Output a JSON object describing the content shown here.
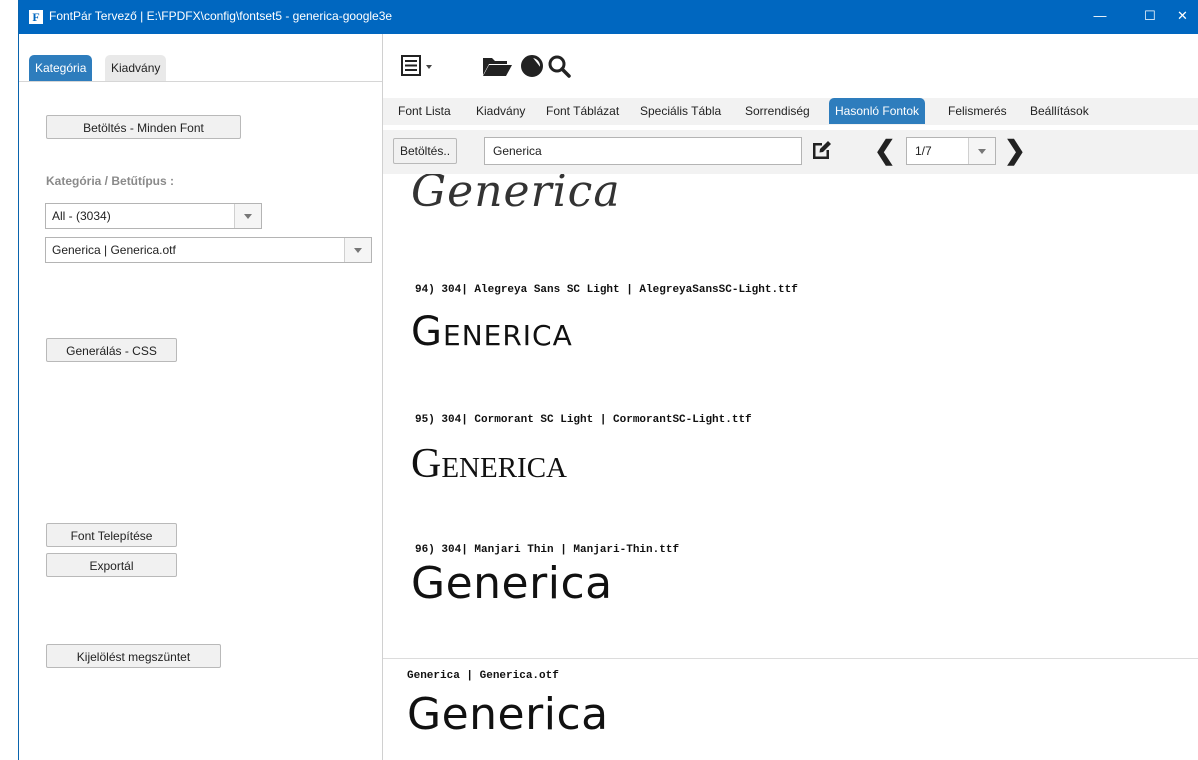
{
  "titlebar": {
    "app_icon": "F",
    "title": "FontPár Tervező | E:\\FPDFX\\config\\fontset5 - generica-google3e",
    "minimize": "—",
    "maximize": "☐",
    "close": "✕"
  },
  "left": {
    "tabs": [
      "Kategória",
      "Kiadvány"
    ],
    "load_all_button": "Betöltés - Minden Font",
    "section_label": "Kategória / Betűtípus :",
    "category_combo": "All - (3034)",
    "font_combo": "Generica | Generica.otf",
    "generate_css_button": "Generálás - CSS",
    "install_font_button": "Font Telepítése",
    "export_button": "Exportál",
    "clear_selection_button": "Kijelölést megszüntet"
  },
  "toolbar": {
    "icons": [
      "list-menu-icon",
      "folder-open-icon",
      "contrast-icon",
      "search-icon"
    ]
  },
  "tabs": [
    "Font Lista",
    "Kiadvány",
    "Font Táblázat",
    "Speciális Tábla",
    "Sorrendiség",
    "Hasonló Fontok",
    "Felismerés",
    "Beállítások"
  ],
  "active_tab": "Hasonló Fontok",
  "searchbar": {
    "load_button": "Betöltés..",
    "query": "Generica",
    "page": "1/7"
  },
  "samples": [
    {
      "label": "",
      "text": "Generica",
      "style": "thin-serif"
    },
    {
      "label": "94) 304| Alegreya Sans SC Light | AlegreyaSansSC-Light.ttf",
      "text": "Generica",
      "style": "alegreya"
    },
    {
      "label": "95) 304| Cormorant SC Light | CormorantSC-Light.ttf",
      "text": "Generica",
      "style": "cormorant"
    },
    {
      "label": "96) 304| Manjari Thin | Manjari-Thin.ttf",
      "text": "Generica",
      "style": "manjari"
    }
  ],
  "preview": {
    "label": "Generica | Generica.otf",
    "text": "Generica"
  },
  "colors": {
    "titlebar": "#0067c0",
    "accent": "#2e7dbd"
  }
}
